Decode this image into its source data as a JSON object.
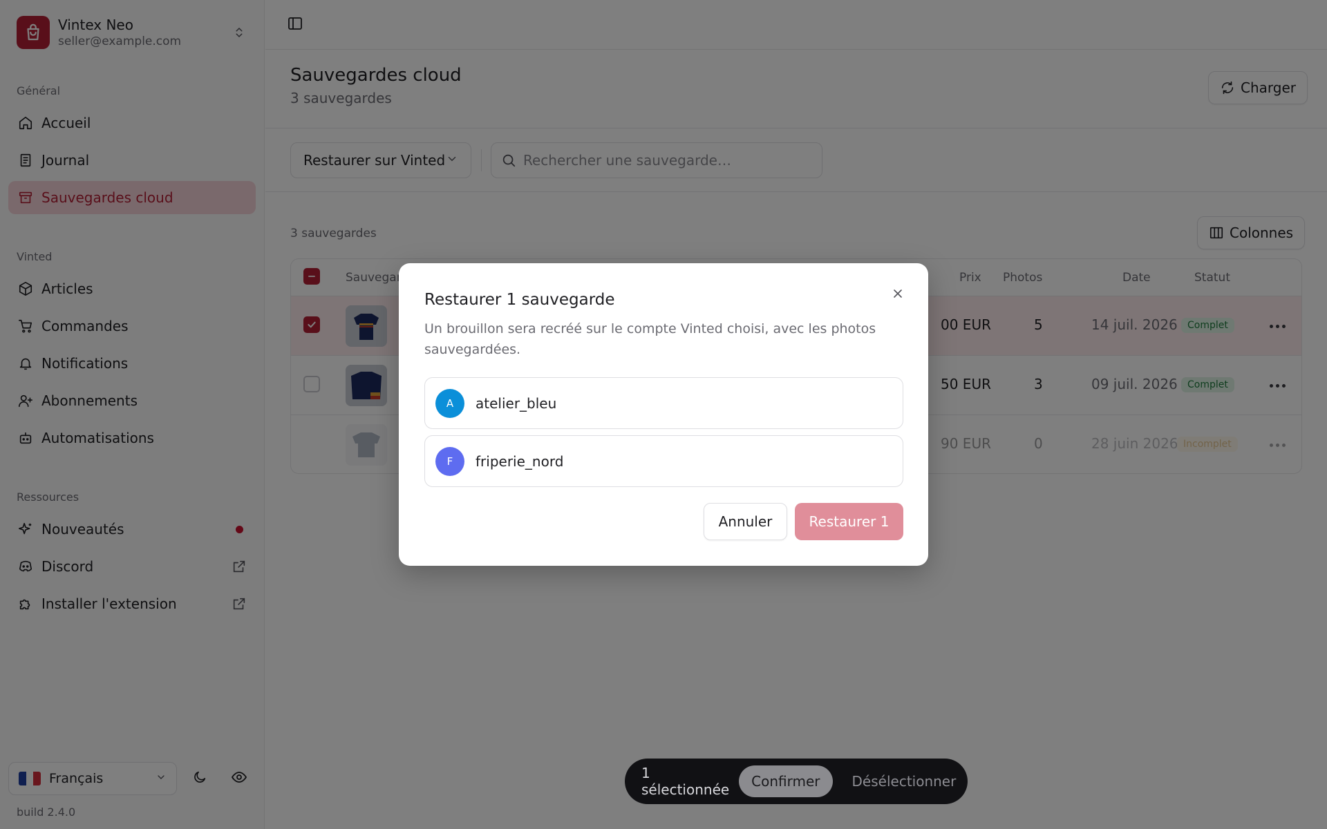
{
  "account": {
    "name": "Vintex Neo",
    "email": "seller@example.com"
  },
  "sidebar": {
    "groups": {
      "general": "Général",
      "vinted": "Vinted",
      "resources": "Ressources"
    },
    "items": {
      "accueil": "Accueil",
      "journal": "Journal",
      "sauvegardes": "Sauvegardes cloud",
      "articles": "Articles",
      "commandes": "Commandes",
      "notifications": "Notifications",
      "abonnements": "Abonnements",
      "automatisations": "Automatisations",
      "nouveautes": "Nouveautés",
      "discord": "Discord",
      "extension": "Installer l'extension"
    },
    "language": "Français",
    "build": "build 2.4.0"
  },
  "header": {
    "title": "Sauvegardes cloud",
    "subtitle": "3 sauvegardes",
    "load_button": "Charger"
  },
  "filters": {
    "action_select": "Restaurer sur Vinted",
    "search_placeholder": "Rechercher une sauvegarde…",
    "columns_button": "Colonnes"
  },
  "table": {
    "count_label": "3 sauvegardes",
    "headers": {
      "name": "Sauvegarde",
      "price": "Prix",
      "photos": "Photos",
      "date": "Date",
      "status": "Statut"
    },
    "rows": [
      {
        "price": "00 EUR",
        "photos": "5",
        "date": "14 juil. 2026",
        "status": "Complet"
      },
      {
        "price": "50 EUR",
        "photos": "3",
        "date": "09 juil. 2026",
        "status": "Complet"
      },
      {
        "price": "90 EUR",
        "photos": "0",
        "date": "28 juin 2026",
        "status": "Incomplet"
      }
    ]
  },
  "dialog": {
    "title": "Restaurer 1 sauvegarde",
    "description": "Un brouillon sera recréé sur le compte Vinted choisi, avec les photos sauvegardées.",
    "accounts": [
      {
        "initial": "A",
        "name": "atelier_bleu",
        "color": "#0b8fd9"
      },
      {
        "initial": "F",
        "name": "friperie_nord",
        "color": "#5e6cf0"
      }
    ],
    "cancel": "Annuler",
    "confirm": "Restaurer 1"
  },
  "actionbar": {
    "count": "1 sélectionnée",
    "confirm": "Confirmer",
    "deselect": "Désélectionner"
  },
  "colors": {
    "brand": "#b31f35",
    "brand_light": "#f4d3d8"
  }
}
